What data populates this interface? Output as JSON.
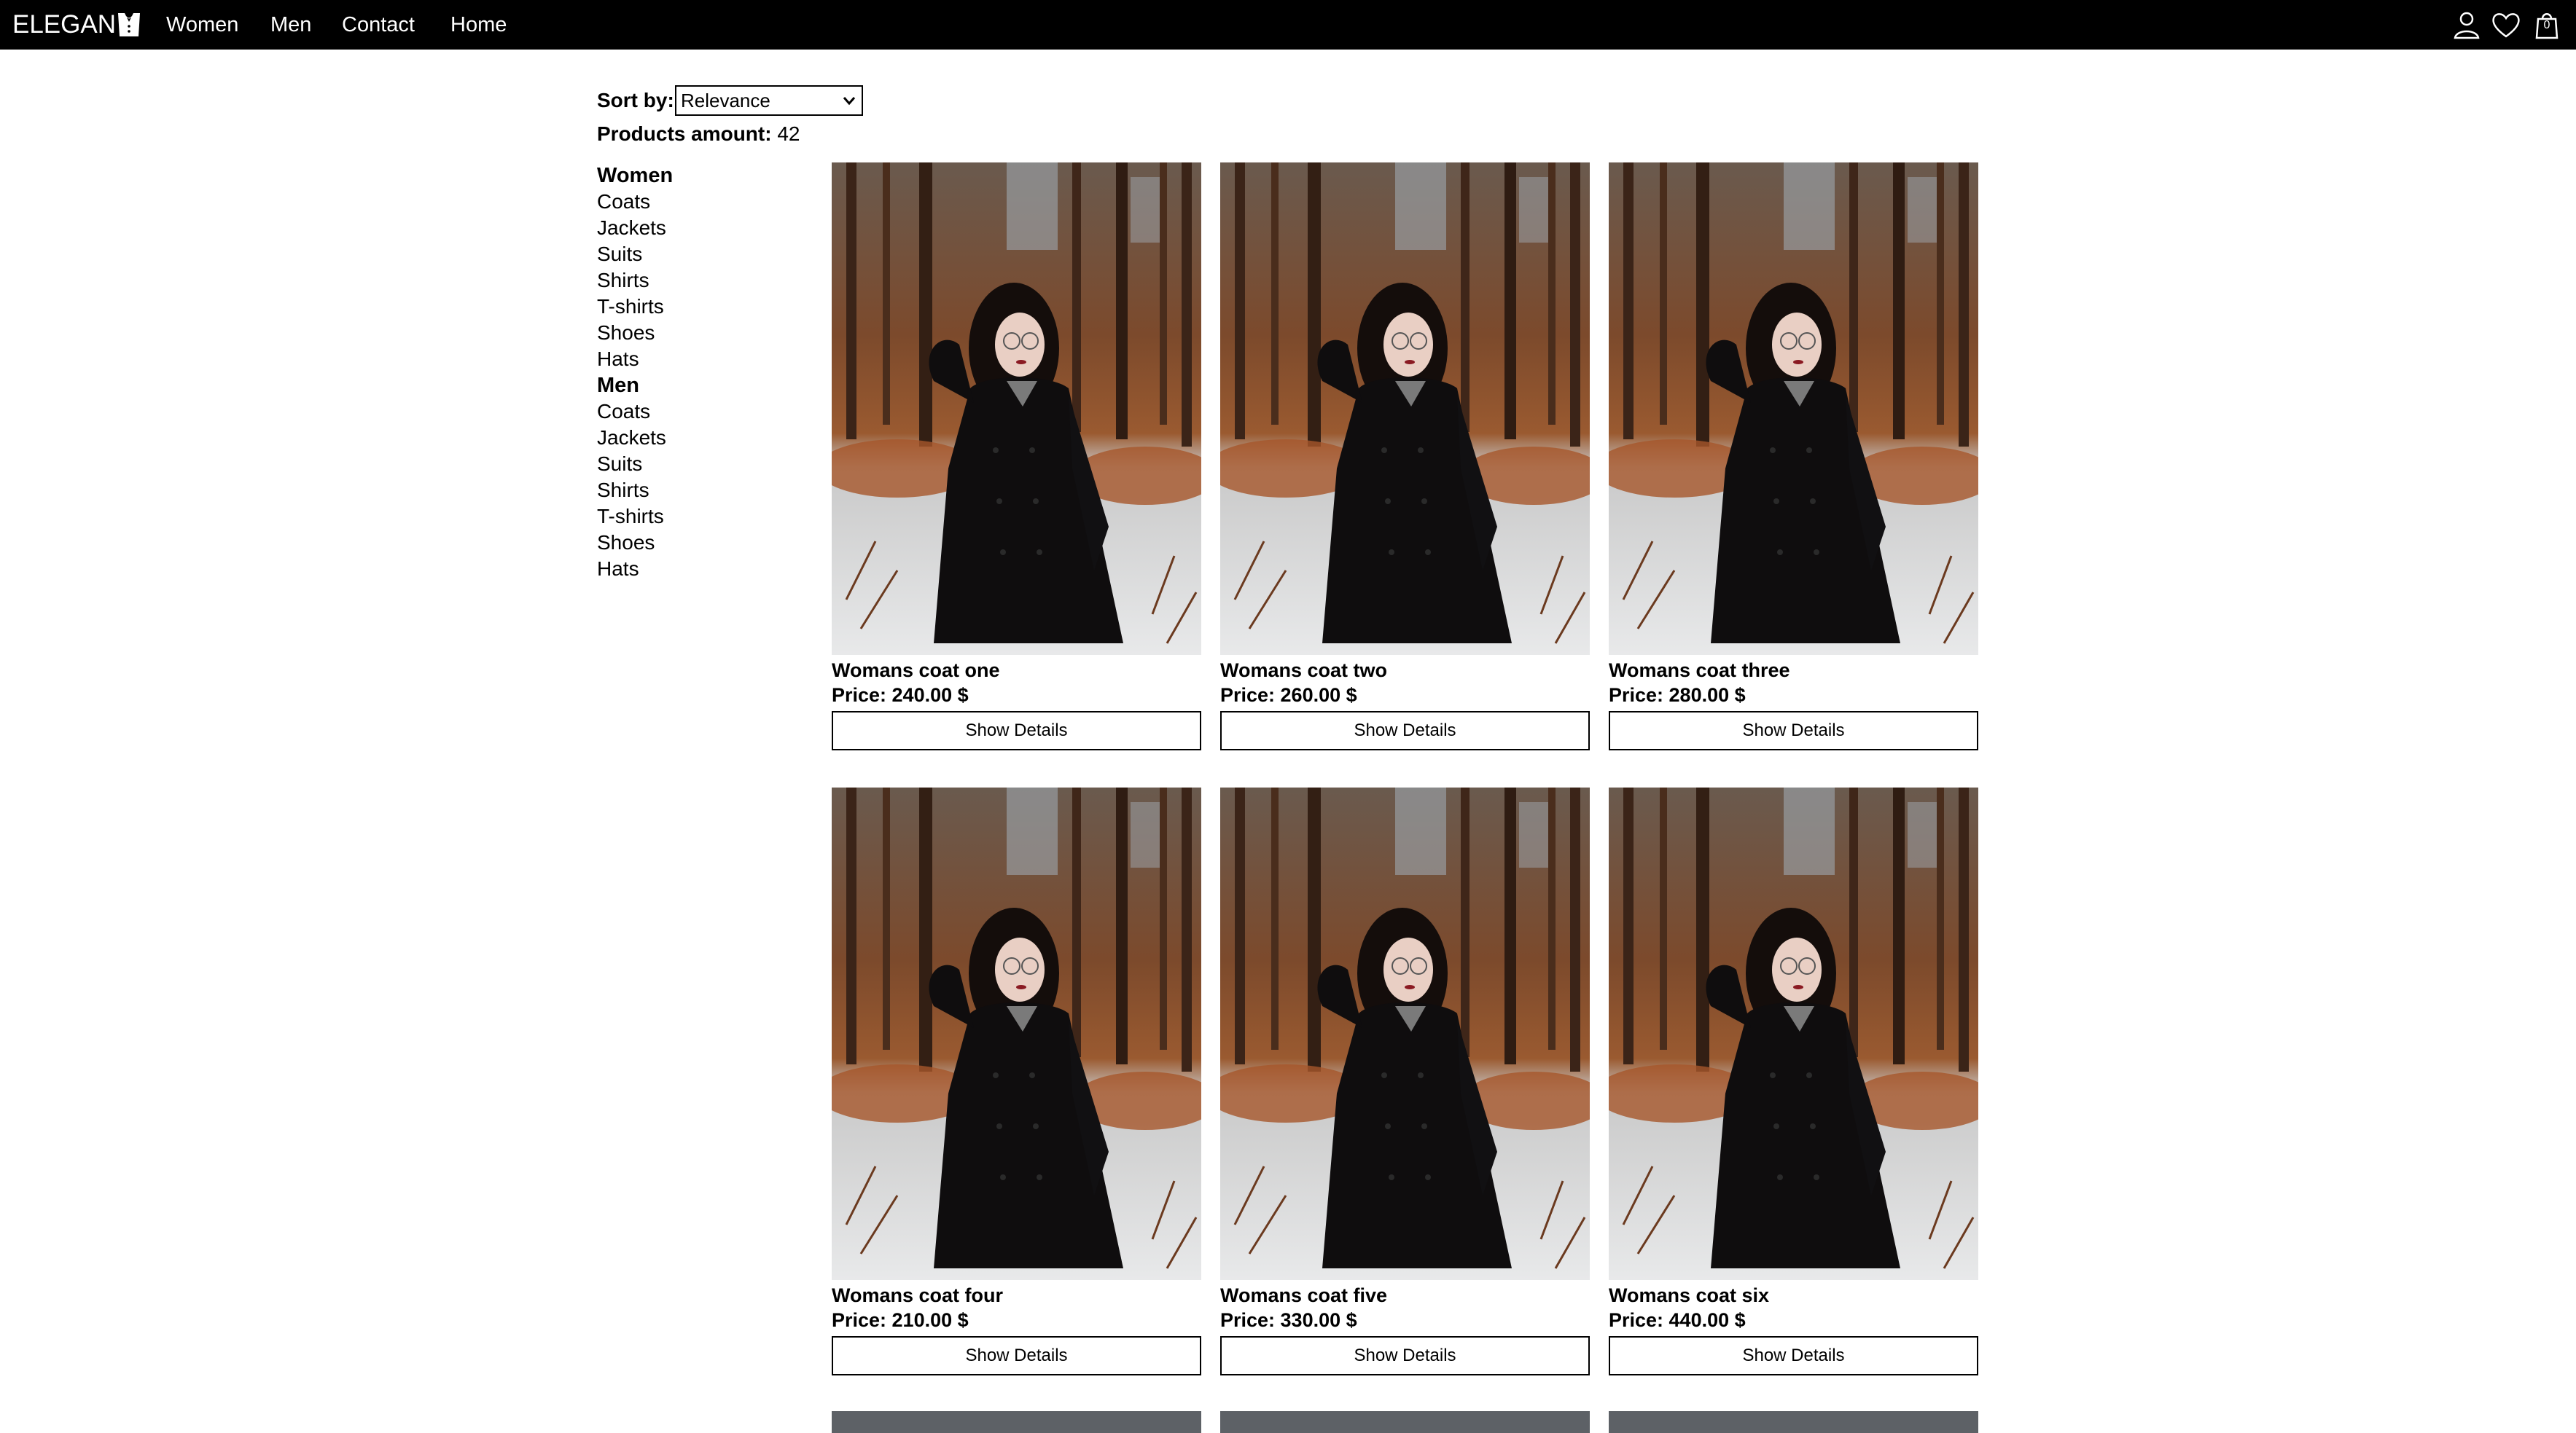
{
  "header": {
    "logo_text": "ELEGAN",
    "nav": [
      "Women",
      "Men",
      "Contact",
      "Home"
    ],
    "cart_count": "0",
    "icons": [
      "user-icon",
      "heart-icon",
      "cart-icon"
    ]
  },
  "sort": {
    "label": "Sort by:",
    "selected": "Relevance"
  },
  "amount": {
    "label": "Products amount:",
    "value": "42"
  },
  "sidebar": {
    "groups": [
      {
        "title": "Women",
        "items": [
          "Coats",
          "Jackets",
          "Suits",
          "Shirts",
          "T-shirts",
          "Shoes",
          "Hats"
        ]
      },
      {
        "title": "Men",
        "items": [
          "Coats",
          "Jackets",
          "Suits",
          "Shirts",
          "T-shirts",
          "Shoes",
          "Hats"
        ]
      }
    ]
  },
  "products": [
    {
      "name": "Womans coat one",
      "price": "Price: 240.00 $",
      "button": "Show Details"
    },
    {
      "name": "Womans coat two",
      "price": "Price: 260.00 $",
      "button": "Show Details"
    },
    {
      "name": "Womans coat three",
      "price": "Price: 280.00 $",
      "button": "Show Details"
    },
    {
      "name": "Womans coat four",
      "price": "Price: 210.00 $",
      "button": "Show Details"
    },
    {
      "name": "Womans coat five",
      "price": "Price: 330.00 $",
      "button": "Show Details"
    },
    {
      "name": "Womans coat six",
      "price": "Price: 440.00 $",
      "button": "Show Details"
    }
  ],
  "colors": {
    "nav_bg": "#000000",
    "page_bg": "#ffffff",
    "text": "#000000"
  }
}
